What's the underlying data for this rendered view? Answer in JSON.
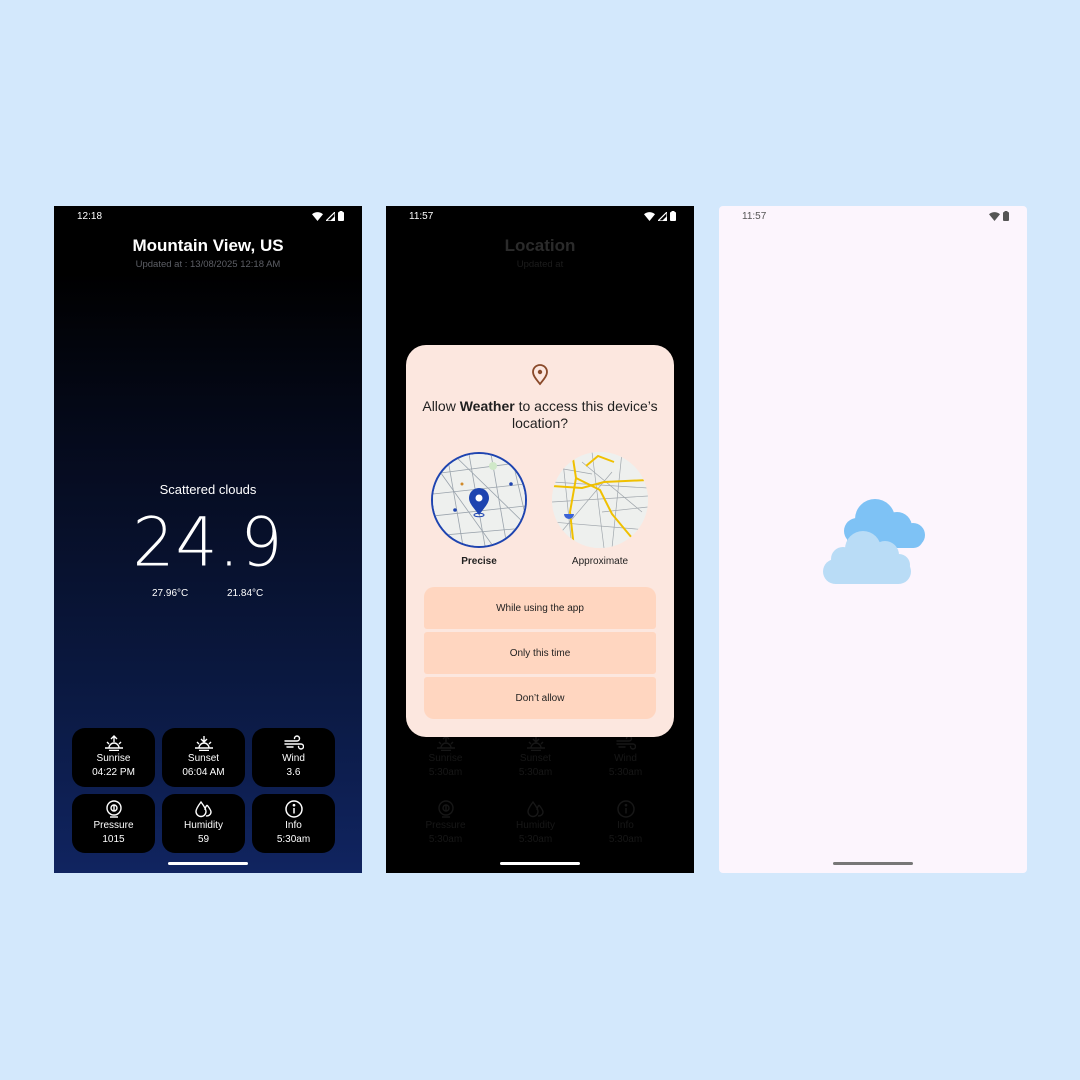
{
  "screen1": {
    "status_time": "12:18",
    "city": "Mountain View, US",
    "updated": "Updated at : 13/08/2025 12:18 AM",
    "condition": "Scattered clouds",
    "temperature": "24.9",
    "temp_min": "27.96°C",
    "temp_max": "21.84°C",
    "tiles": [
      {
        "icon": "sunrise-icon",
        "label": "Sunrise",
        "value": "04:22 PM"
      },
      {
        "icon": "sunset-icon",
        "label": "Sunset",
        "value": "06:04 AM"
      },
      {
        "icon": "wind-icon",
        "label": "Wind",
        "value": "3.6"
      },
      {
        "icon": "pressure-icon",
        "label": "Pressure",
        "value": "1015"
      },
      {
        "icon": "humidity-icon",
        "label": "Humidity",
        "value": "59"
      },
      {
        "icon": "info-icon",
        "label": "Info",
        "value": "5:30am"
      }
    ]
  },
  "screen2": {
    "status_time": "11:57",
    "city": "Location",
    "updated": "Updated at",
    "dialog": {
      "title_prefix": "Allow ",
      "app_name": "Weather",
      "title_suffix": " to access this device’s location?",
      "precise_label": "Precise",
      "approximate_label": "Approximate",
      "options": [
        "While using the app",
        "Only this time",
        "Don’t allow"
      ]
    },
    "tiles": [
      {
        "label": "Sunrise",
        "value": "5:30am"
      },
      {
        "label": "Sunset",
        "value": "5:30am"
      },
      {
        "label": "Wind",
        "value": "5:30am"
      },
      {
        "label": "Pressure",
        "value": "5:30am"
      },
      {
        "label": "Humidity",
        "value": "5:30am"
      },
      {
        "label": "Info",
        "value": "5:30am"
      }
    ]
  },
  "screen3": {
    "status_time": "11:57",
    "icon": "cloud-icon"
  },
  "colors": {
    "page_bg": "#d3e8fc",
    "dialog_bg": "#fce7df",
    "option_bg": "#ffd6c0",
    "precise_ring": "#1e44b0",
    "cloud_front": "#b9dcf6",
    "cloud_back": "#7ec2f5",
    "splash_bg": "#fcf5fd"
  }
}
